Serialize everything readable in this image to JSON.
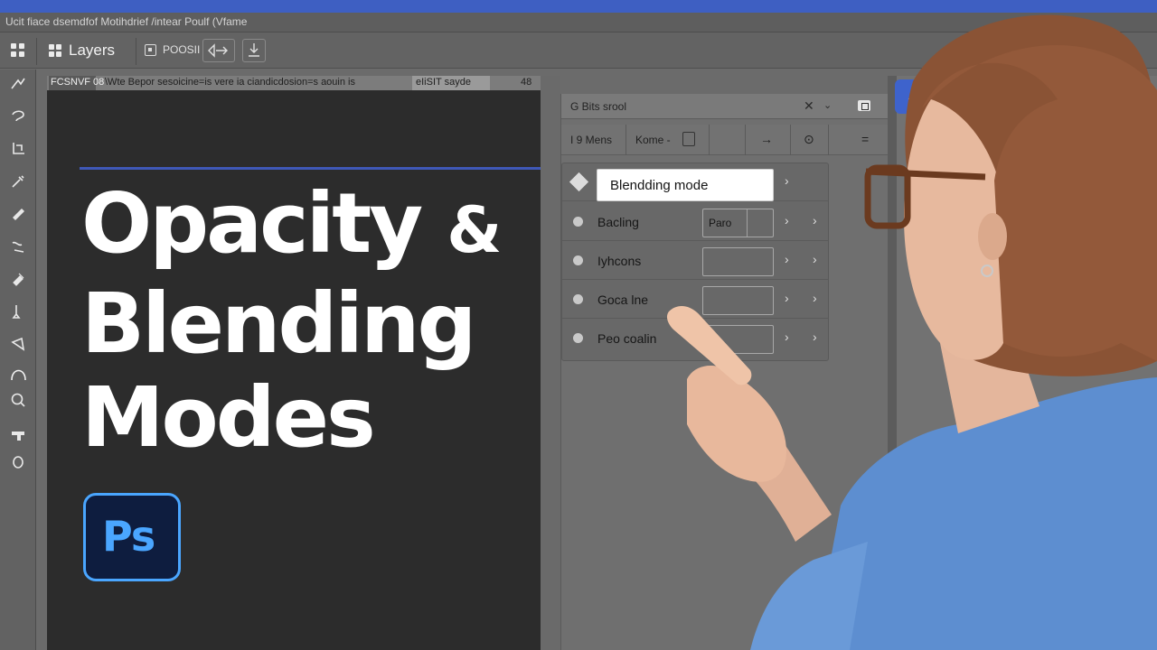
{
  "menubar": {
    "text": "Ucit fiace dsemdfof  Motihdrief  /intear  Poulf  (Vfame"
  },
  "toolbar": {
    "layers_label": "Layers",
    "focus_label": "POOSII"
  },
  "canvas": {
    "tab_text_left": "FCSNVF 08",
    "tab_text_mid": "\\Wte  Bepor sesoicine=is vere ia ciandicdosion=s aouin is",
    "tab_text_hl": "eIiSIT sayde",
    "tab_text_right": "48",
    "title_line1": "Opacity",
    "title_amp": "&",
    "title_line2": "Blending",
    "title_line3": "Modes",
    "logo_text": "Ps"
  },
  "panel": {
    "title": "G Bits  srool",
    "tools": {
      "menu_label": "I 9 Mens",
      "kome_label": "Kome -",
      "arrow_glyph": "→",
      "circle_glyph": "⊙",
      "menu_glyph": "="
    },
    "rows": [
      {
        "name": "Blendding mode",
        "kind": "input"
      },
      {
        "name": "Bacling",
        "field": "Paro"
      },
      {
        "name": "Iyhcons",
        "field": ""
      },
      {
        "name": "Goca lne",
        "field": ""
      },
      {
        "name": "Peo coalin",
        "field": ""
      }
    ],
    "close_glyph": "✕",
    "chevron_glyph": "⌄",
    "arrow_glyph": "›"
  },
  "right_dock": {
    "button_glyph": "▲"
  },
  "colors": {
    "accent_blue": "#3e5fc2",
    "ps_logo_border": "#4aa6ff",
    "ps_logo_bg": "#0e1d3f"
  }
}
